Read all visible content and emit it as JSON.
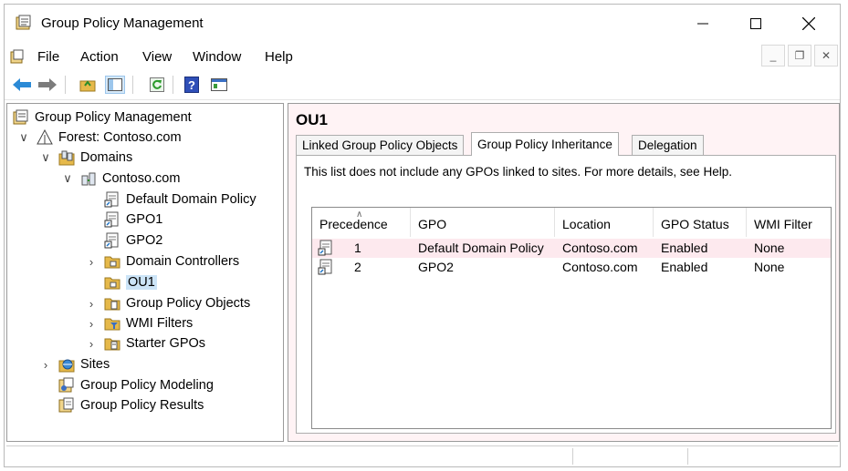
{
  "window": {
    "title": "Group Policy Management"
  },
  "menu": {
    "items": [
      "File",
      "Action",
      "View",
      "Window",
      "Help"
    ]
  },
  "tree": {
    "root": "Group Policy Management",
    "forest": "Forest: Contoso.com",
    "domains": "Domains",
    "domain": "Contoso.com",
    "items": [
      "Default Domain Policy",
      "GPO1",
      "GPO2",
      "Domain Controllers",
      "OU1",
      "Group Policy Objects",
      "WMI Filters",
      "Starter GPOs"
    ],
    "sites": "Sites",
    "modeling": "Group Policy Modeling",
    "results": "Group Policy Results"
  },
  "content": {
    "title": "OU1",
    "tabs": [
      "Linked Group Policy Objects",
      "Group Policy Inheritance",
      "Delegation"
    ],
    "info": "This list does not include any GPOs linked to sites. For more details, see Help.",
    "columns": [
      "Precedence",
      "GPO",
      "Location",
      "GPO Status",
      "WMI Filter"
    ],
    "rows": [
      {
        "precedence": "1",
        "gpo": "Default Domain Policy",
        "location": "Contoso.com",
        "status": "Enabled",
        "wmi": "None"
      },
      {
        "precedence": "2",
        "gpo": "GPO2",
        "location": "Contoso.com",
        "status": "Enabled",
        "wmi": "None"
      }
    ]
  },
  "icons": {
    "app": "gpmc-icon",
    "forest": "forest-icon",
    "domains": "domains-icon",
    "domain": "domain-icon",
    "gpo-link": "gpo-link-icon",
    "ou": "folder-icon",
    "wmi": "wmi-filter-icon",
    "sites": "sites-icon",
    "modeling": "modeling-icon",
    "results": "results-icon"
  },
  "colors": {
    "accent": "#1e74c6",
    "folder": "#e6b94a",
    "selected": "#cce4f7",
    "alt_row": "#fde9ee"
  }
}
